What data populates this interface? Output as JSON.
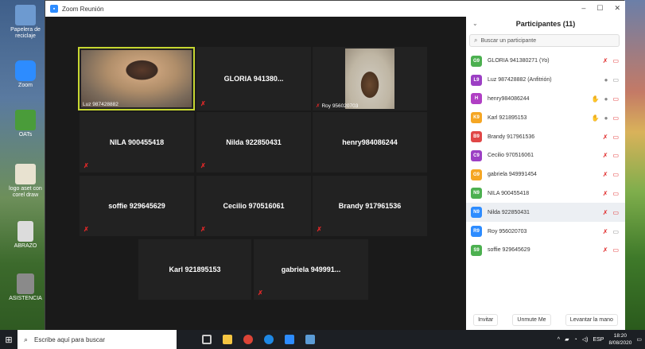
{
  "window": {
    "title": "Zoom Reunión"
  },
  "desktop_icons": [
    {
      "label": "Papelera de reciclaje",
      "color": "#6d9ad0"
    },
    {
      "label": "Zoom",
      "color": "#2d8cff"
    },
    {
      "label": "OATs",
      "color": "#4a9c3a"
    },
    {
      "label": "logo aset con corel draw",
      "color": "#e8e2d0"
    },
    {
      "label": "ABRAZO",
      "color": "#dcdcdc"
    },
    {
      "label": "ASISTENCIA",
      "color": "#8a8a8a"
    }
  ],
  "tiles": [
    {
      "name": "Luz 987428882",
      "video": true
    },
    {
      "name": "GLORIA 941380..."
    },
    {
      "name": "Roy 956020703",
      "video": true
    },
    {
      "name": "NILA 900455418"
    },
    {
      "name": "Nilda 922850431"
    },
    {
      "name": "henry984086244"
    },
    {
      "name": "soffie 929645629"
    },
    {
      "name": "Cecilio 970516061"
    },
    {
      "name": "Brandy 917961536"
    },
    {
      "name": "Karl 921895153"
    },
    {
      "name": "gabriela 949991..."
    }
  ],
  "panel": {
    "title": "Participantes (11)",
    "search_placeholder": "Buscar un participante",
    "participants": [
      {
        "initials": "G9",
        "color": "#4cb050",
        "name": "GLORIA 941380271 (Yo)"
      },
      {
        "initials": "L9",
        "color": "#9c3fc4",
        "name": "Luz 987428882 (Anfitrión)"
      },
      {
        "initials": "H",
        "color": "#b03fc4",
        "name": "henry984086244"
      },
      {
        "initials": "K9",
        "color": "#f5a623",
        "name": "Karl 921895153"
      },
      {
        "initials": "B9",
        "color": "#e04646",
        "name": "Brandy 917961536"
      },
      {
        "initials": "C9",
        "color": "#9c3fc4",
        "name": "Cecilio 970516061"
      },
      {
        "initials": "G9",
        "color": "#f5a623",
        "name": "gabriela 949991454"
      },
      {
        "initials": "N9",
        "color": "#4cb050",
        "name": "NILA 900455418"
      },
      {
        "initials": "N9",
        "color": "#2d8cff",
        "name": "Nilda 922850431"
      },
      {
        "initials": "R9",
        "color": "#2d8cff",
        "name": "Roy 956020703"
      },
      {
        "initials": "S9",
        "color": "#4cb050",
        "name": "soffie 929645629"
      }
    ],
    "buttons": {
      "invite": "Invitar",
      "unmute": "Unmute Me",
      "lower_hand": "Levantar la mano"
    }
  },
  "taskbar": {
    "search_placeholder": "Escribe aquí para buscar",
    "language": "ESP",
    "time": "18:20",
    "date": "8/08/2020"
  }
}
